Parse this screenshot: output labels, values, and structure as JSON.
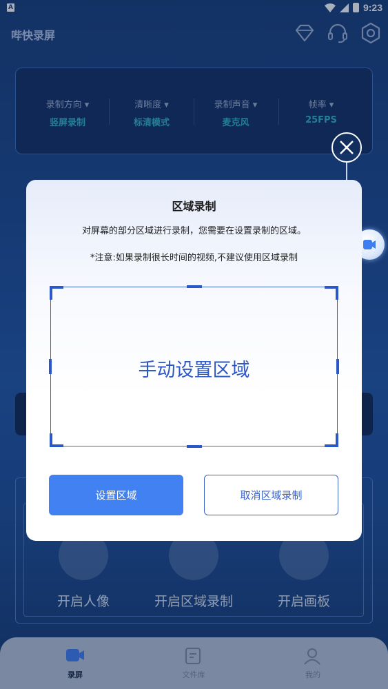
{
  "status_bar": {
    "time": "9:23",
    "left_badge": "A"
  },
  "app": {
    "title": "哔快录屏"
  },
  "icons": {
    "diamond": "diamond-icon",
    "headset": "headset-icon",
    "settings": "hexagon-settings-icon"
  },
  "settings": [
    {
      "label": "录制方向 ▾",
      "value": "竖屏录制"
    },
    {
      "label": "清晰度 ▾",
      "value": "标清模式"
    },
    {
      "label": "录制声音 ▾",
      "value": "麦克风"
    },
    {
      "label": "帧率 ▾",
      "value": "25FPS"
    }
  ],
  "features": [
    {
      "label": "开启人像"
    },
    {
      "label": "开启区域录制"
    },
    {
      "label": "开启画板"
    }
  ],
  "bottom_nav": [
    {
      "label": "录屏",
      "active": true
    },
    {
      "label": "文件库",
      "active": false
    },
    {
      "label": "我的",
      "active": false
    }
  ],
  "dialog": {
    "title": "区域录制",
    "description": "对屏幕的部分区域进行录制，您需要在设置录制的区域。",
    "note": "*注意:如果录制很长时间的视频,不建议使用区域录制",
    "area_label": "手动设置区域",
    "confirm_label": "设置区域",
    "cancel_label": "取消区域录制"
  },
  "colors": {
    "primary": "#4181f1",
    "accent_text": "#37b3c9",
    "area_blue": "#2c57c9"
  }
}
